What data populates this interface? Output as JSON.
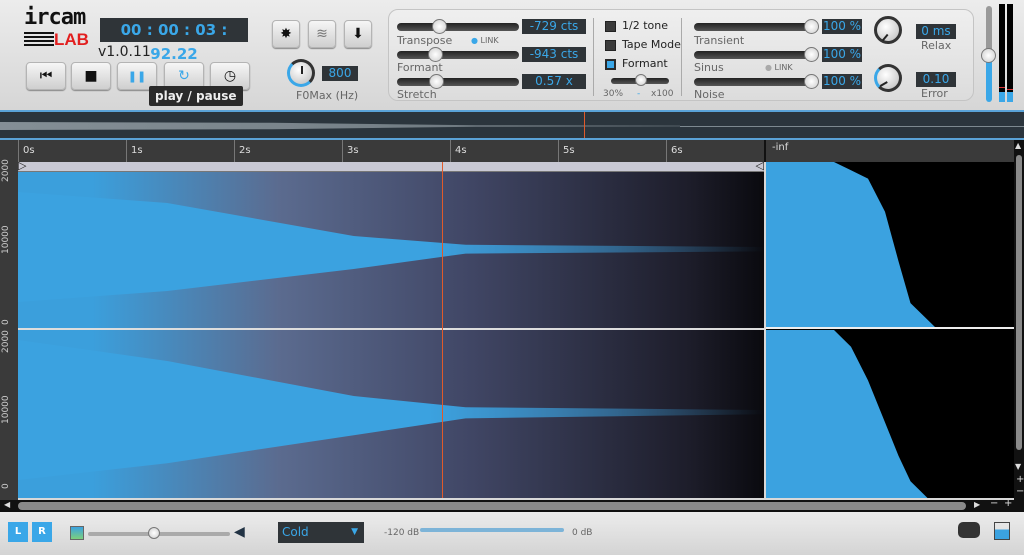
{
  "app": {
    "logo_top": "ircam",
    "logo_bottom": "LAB",
    "version": "v1.0.11"
  },
  "transport": {
    "timer": "00 : 00 : 03 : 92.22",
    "buttons": [
      {
        "name": "rewind",
        "glyph": "⏮"
      },
      {
        "name": "stop",
        "glyph": "■"
      },
      {
        "name": "play-pause",
        "glyph": "❚❚"
      },
      {
        "name": "loop",
        "glyph": "↻"
      },
      {
        "name": "timer-mode",
        "glyph": "◷"
      }
    ],
    "tooltip": "play / pause"
  },
  "tools": {
    "settings_glyph": "✸",
    "wave_glyph": "≋",
    "download_glyph": "⬇"
  },
  "f0max": {
    "value": "800",
    "label": "F0Max (Hz)"
  },
  "pitch": {
    "transpose": {
      "label": "Transpose",
      "value": "-729 cts",
      "position": 0.2
    },
    "link_label": "LINK",
    "formant": {
      "label": "Formant",
      "value": "-943 cts",
      "position": 0.15
    },
    "stretch": {
      "label": "Stretch",
      "value": "0.57 x",
      "position": 0.17
    }
  },
  "modes": {
    "half_tone": {
      "label": "1/2 tone",
      "checked": false
    },
    "tape_mode": {
      "label": "Tape Mode",
      "checked": false
    },
    "formant": {
      "label": "Formant",
      "checked": true
    },
    "range_min": "30%",
    "range_mid": "-",
    "range_max": "x100"
  },
  "components": {
    "transient": {
      "label": "Transient",
      "value": "100 %"
    },
    "sinus": {
      "label": "Sinus",
      "value": "100 %"
    },
    "link_label": "LINK",
    "noise": {
      "label": "Noise",
      "value": "100 %"
    },
    "relax": {
      "label": "Relax",
      "value": "0 ms"
    },
    "error": {
      "label": "Error",
      "value": "0.10"
    }
  },
  "timeline": {
    "ticks": [
      "0s",
      "1s",
      "2s",
      "3s",
      "4s",
      "5s",
      "6s"
    ],
    "level_label": "-inf"
  },
  "freq_axis": {
    "top": [
      "2000",
      "10000",
      "0"
    ],
    "bottom": [
      "2000",
      "10000",
      "0"
    ]
  },
  "footer": {
    "left": "L",
    "right": "R",
    "colormap": "Cold",
    "range_min": "-120 dB",
    "range_max": "0 dB"
  },
  "colors": {
    "accent": "#3aa7e8",
    "cursor": "#e05a2a",
    "logo_red": "#e21f1f"
  }
}
